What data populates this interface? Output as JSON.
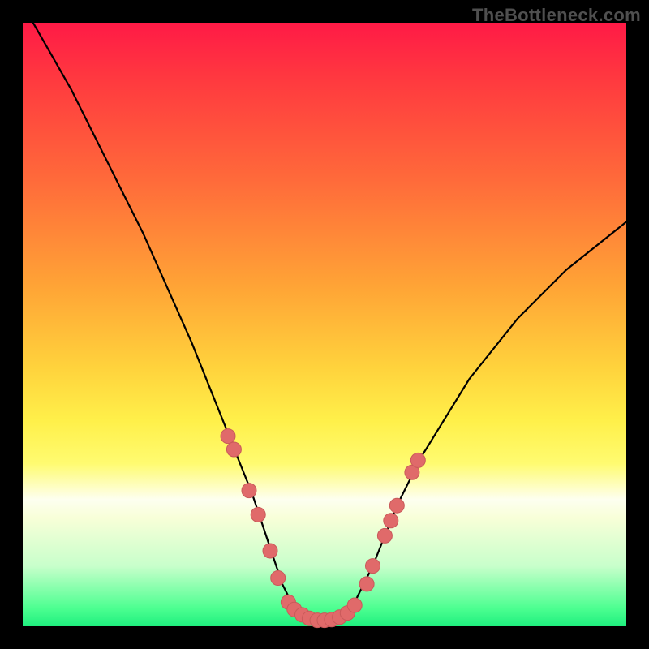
{
  "watermark": "TheBottleneck.com",
  "colors": {
    "frame": "#000000",
    "curve_stroke": "#000000",
    "marker_fill": "#e06a6a",
    "marker_stroke": "#c95a5a"
  },
  "chart_data": {
    "type": "line",
    "title": "",
    "xlabel": "",
    "ylabel": "",
    "xlim": [
      0,
      100
    ],
    "ylim": [
      0,
      100
    ],
    "grid": false,
    "legend": false,
    "series": [
      {
        "name": "bottleneck-curve",
        "x": [
          0,
          4,
          8,
          12,
          16,
          20,
          24,
          28,
          32,
          34,
          36,
          38,
          40,
          42,
          43,
          44,
          46,
          48,
          50,
          52,
          54,
          55,
          56,
          58,
          60,
          62,
          66,
          74,
          82,
          90,
          100
        ],
        "y": [
          103,
          96,
          89,
          81,
          73,
          65,
          56,
          47,
          37,
          32,
          27,
          22,
          16,
          10,
          7,
          5,
          2.5,
          1.3,
          1,
          1.3,
          2.5,
          4,
          6,
          10,
          15,
          20,
          28,
          41,
          51,
          59,
          67
        ]
      }
    ],
    "markers": [
      {
        "x": 34.0,
        "y": 31.5
      },
      {
        "x": 35.0,
        "y": 29.3
      },
      {
        "x": 37.5,
        "y": 22.5
      },
      {
        "x": 39.0,
        "y": 18.5
      },
      {
        "x": 41.0,
        "y": 12.5
      },
      {
        "x": 42.3,
        "y": 8.0
      },
      {
        "x": 44.0,
        "y": 4.0
      },
      {
        "x": 45.0,
        "y": 2.8
      },
      {
        "x": 46.3,
        "y": 1.9
      },
      {
        "x": 47.5,
        "y": 1.3
      },
      {
        "x": 48.8,
        "y": 1.0
      },
      {
        "x": 50.0,
        "y": 1.0
      },
      {
        "x": 51.2,
        "y": 1.1
      },
      {
        "x": 52.5,
        "y": 1.5
      },
      {
        "x": 53.8,
        "y": 2.2
      },
      {
        "x": 55.0,
        "y": 3.5
      },
      {
        "x": 57.0,
        "y": 7.0
      },
      {
        "x": 58.0,
        "y": 10.0
      },
      {
        "x": 60.0,
        "y": 15.0
      },
      {
        "x": 61.0,
        "y": 17.5
      },
      {
        "x": 62.0,
        "y": 20.0
      },
      {
        "x": 64.5,
        "y": 25.5
      },
      {
        "x": 65.5,
        "y": 27.5
      }
    ]
  }
}
